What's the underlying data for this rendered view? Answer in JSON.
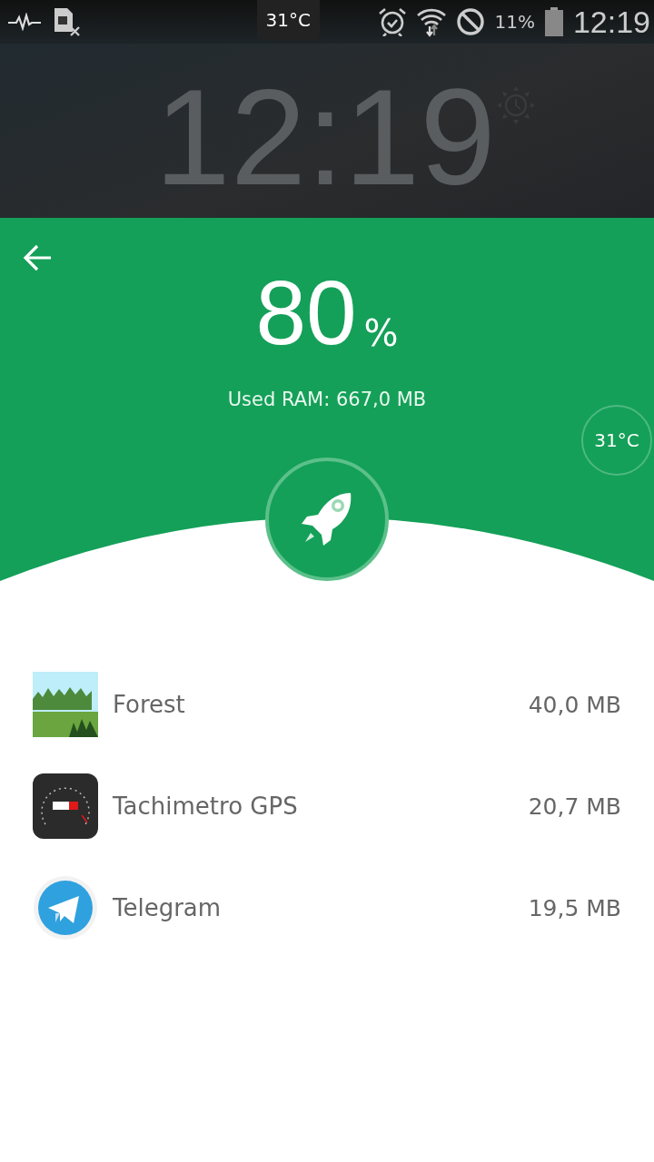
{
  "status_bar": {
    "temperature": "31°C",
    "battery": "11%",
    "time": "12:19"
  },
  "clock_widget": {
    "time": "12:19"
  },
  "memory": {
    "percent": "80",
    "unit": "%",
    "used": "Used RAM: 667,0 MB",
    "temperature": "31°C"
  },
  "apps": [
    {
      "name": "Forest",
      "size": "40,0 MB"
    },
    {
      "name": "Tachimetro GPS",
      "size": "20,7 MB"
    },
    {
      "name": "Telegram",
      "size": "19,5 MB"
    }
  ]
}
